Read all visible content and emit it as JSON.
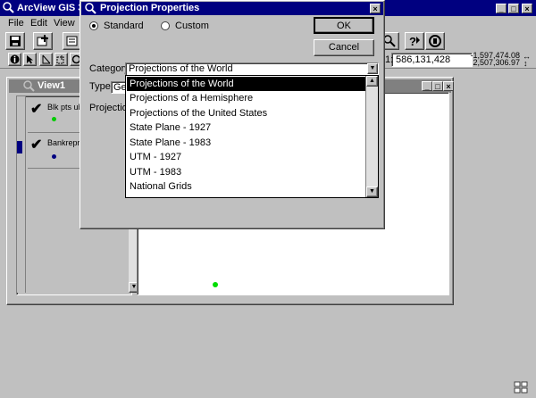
{
  "app": {
    "title": "ArcView GIS 3",
    "menu": [
      "File",
      "Edit",
      "View"
    ],
    "coords": {
      "scale_prefix": "1:",
      "scale": "586,131,428",
      "x": "-1,597,474.08",
      "y": "2,507,306.97"
    },
    "desktop_icon": "grid-icon"
  },
  "view_window": {
    "title": "View1",
    "layers": [
      {
        "name": "Blk pts ub...",
        "checked": true,
        "color": "#00cc00"
      },
      {
        "name": "Bankrepr...",
        "checked": true,
        "color": "#000080"
      }
    ],
    "point_color": "#00dd00"
  },
  "dialog": {
    "title": "Projection Properties",
    "radio_standard": "Standard",
    "radio_custom": "Custom",
    "ok_label": "OK",
    "cancel_label": "Cancel",
    "category_label": "Category:",
    "category_value": "Projections of the World",
    "type_label": "Type:",
    "type_value_partial": "Ge",
    "projection_label": "Projection:",
    "dropdown_items": [
      "Projections of the World",
      "Projections of a Hemisphere",
      "Projections of the United States",
      "State Plane - 1927",
      "State Plane - 1983",
      "UTM - 1927",
      "UTM - 1983",
      "National Grids"
    ],
    "selected_index": 0
  }
}
